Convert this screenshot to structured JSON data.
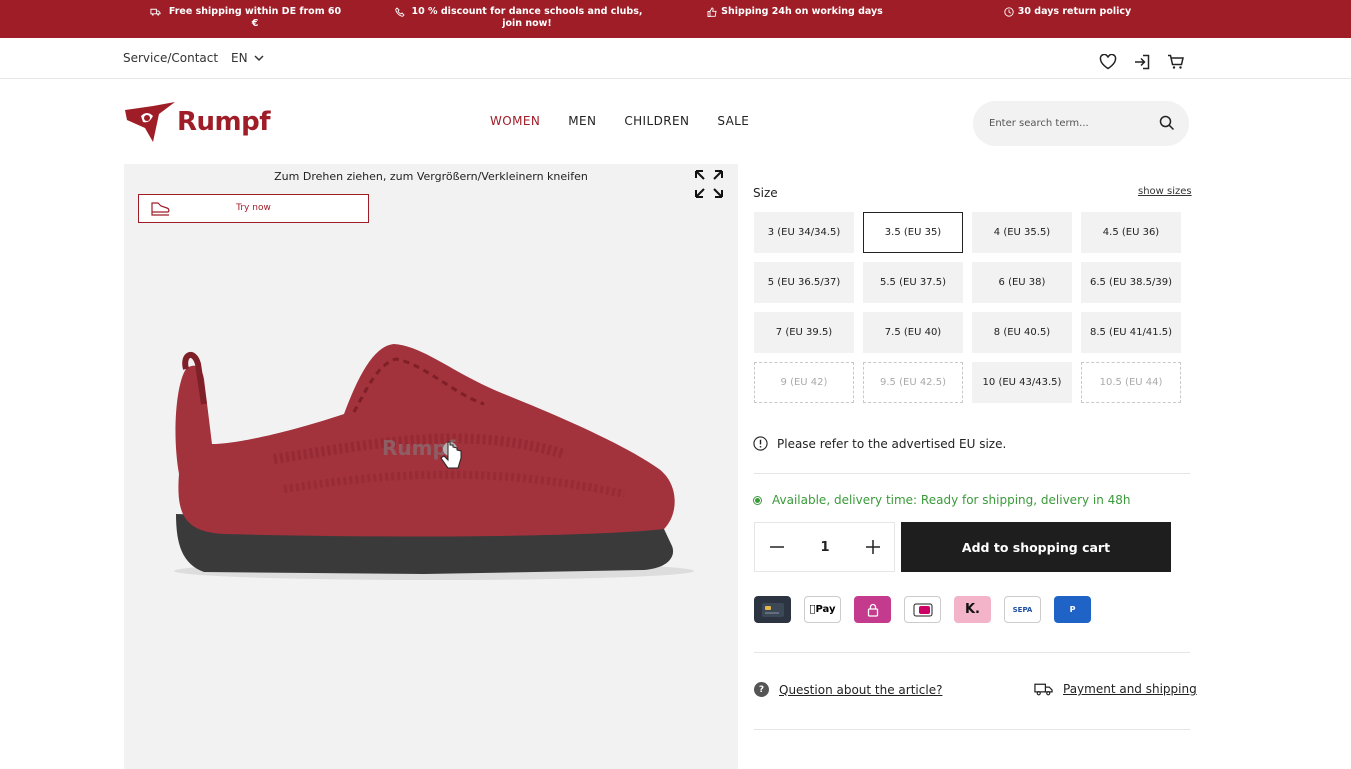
{
  "promo_bar": {
    "items": [
      {
        "icon": "truck-icon",
        "text": "Free shipping within DE from 60 €"
      },
      {
        "icon": "phone-icon",
        "text": "10 % discount for dance schools and clubs, join now!"
      },
      {
        "icon": "thumbs-up-icon",
        "text": "Shipping 24h on working days"
      },
      {
        "icon": "clock-icon",
        "text": "30 days return policy"
      }
    ],
    "color": "#9f1d27"
  },
  "service_bar": {
    "service_label": "Service/Contact",
    "language": "EN",
    "icons": [
      "heart-icon",
      "login-icon",
      "cart-icon"
    ]
  },
  "header": {
    "logo_text": "Rumpf",
    "nav": [
      "WOMEN",
      "MEN",
      "CHILDREN",
      "SALE"
    ],
    "active_nav": "WOMEN",
    "search_placeholder": "Enter search term..."
  },
  "image_panel": {
    "hint": "Zum Drehen ziehen, zum Vergrößern/Verkleinern kneifen",
    "try_now": "Try now",
    "shoe_logo": "Rumpf"
  },
  "sizes": {
    "title": "Size",
    "show_sizes": "show sizes",
    "options": [
      {
        "label": "3 (EU 34/34.5)",
        "state": "available"
      },
      {
        "label": "3.5 (EU 35)",
        "state": "selected"
      },
      {
        "label": "4 (EU 35.5)",
        "state": "available"
      },
      {
        "label": "4.5 (EU 36)",
        "state": "available"
      },
      {
        "label": "5 (EU 36.5/37)",
        "state": "available"
      },
      {
        "label": "5.5 (EU 37.5)",
        "state": "available"
      },
      {
        "label": "6 (EU 38)",
        "state": "available"
      },
      {
        "label": "6.5 (EU 38.5/39)",
        "state": "available"
      },
      {
        "label": "7 (EU 39.5)",
        "state": "available"
      },
      {
        "label": "7.5 (EU 40)",
        "state": "available"
      },
      {
        "label": "8 (EU 40.5)",
        "state": "available"
      },
      {
        "label": "8.5 (EU 41/41.5)",
        "state": "available"
      },
      {
        "label": "9 (EU 42)",
        "state": "unavailable"
      },
      {
        "label": "9.5 (EU 42.5)",
        "state": "unavailable"
      },
      {
        "label": "10 (EU 43/43.5)",
        "state": "available"
      },
      {
        "label": "10.5 (EU 44)",
        "state": "unavailable"
      }
    ],
    "note": "Please refer to the advertised EU size."
  },
  "purchase": {
    "availability": "Available, delivery time: Ready for shipping, delivery in 48h",
    "quantity": "1",
    "add_to_cart": "Add to shopping cart"
  },
  "payments": {
    "apple_pay": "Pay",
    "klarna": "K.",
    "sepa": "SEPA",
    "paypal": "P"
  },
  "footer_links": {
    "question": "Question about the article?",
    "question_icon": "?",
    "payment_shipping": "Payment and shipping"
  }
}
